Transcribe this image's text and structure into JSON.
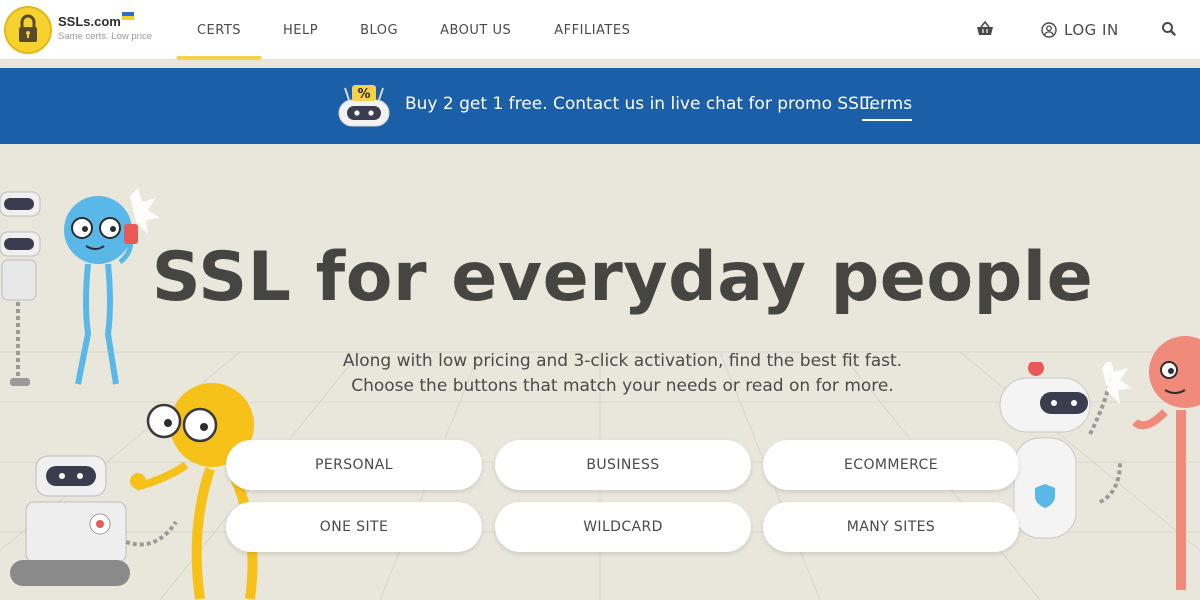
{
  "header": {
    "logo": {
      "name": "SSLs.com",
      "tagline": "Same certs. Low price"
    },
    "nav": [
      {
        "label": "CERTS",
        "active": true
      },
      {
        "label": "HELP"
      },
      {
        "label": "BLOG"
      },
      {
        "label": "ABOUT US"
      },
      {
        "label": "AFFILIATES"
      }
    ],
    "cart_icon": "basket-icon",
    "login_label": "LOG IN",
    "login_icon": "user-icon",
    "search_icon": "search-icon"
  },
  "banner": {
    "text": "Buy 2 get 1 free. Contact us in live chat for promo SSL.",
    "link": "Terms",
    "icon": "percent-robot-icon"
  },
  "hero": {
    "title": "SSL for everyday people",
    "subtitle_line1": "Along with low pricing and 3-click activation, find the best fit fast.",
    "subtitle_line2": "Choose the buttons that match your needs or read on for more.",
    "buttons_row1": [
      "PERSONAL",
      "BUSINESS",
      "ECOMMERCE"
    ],
    "buttons_row2": [
      "ONE SITE",
      "WILDCARD",
      "MANY SITES"
    ]
  },
  "colors": {
    "accent": "#f6d24a",
    "banner": "#1b5fa8",
    "background": "#e9e6dc",
    "text": "#4a4a48"
  }
}
